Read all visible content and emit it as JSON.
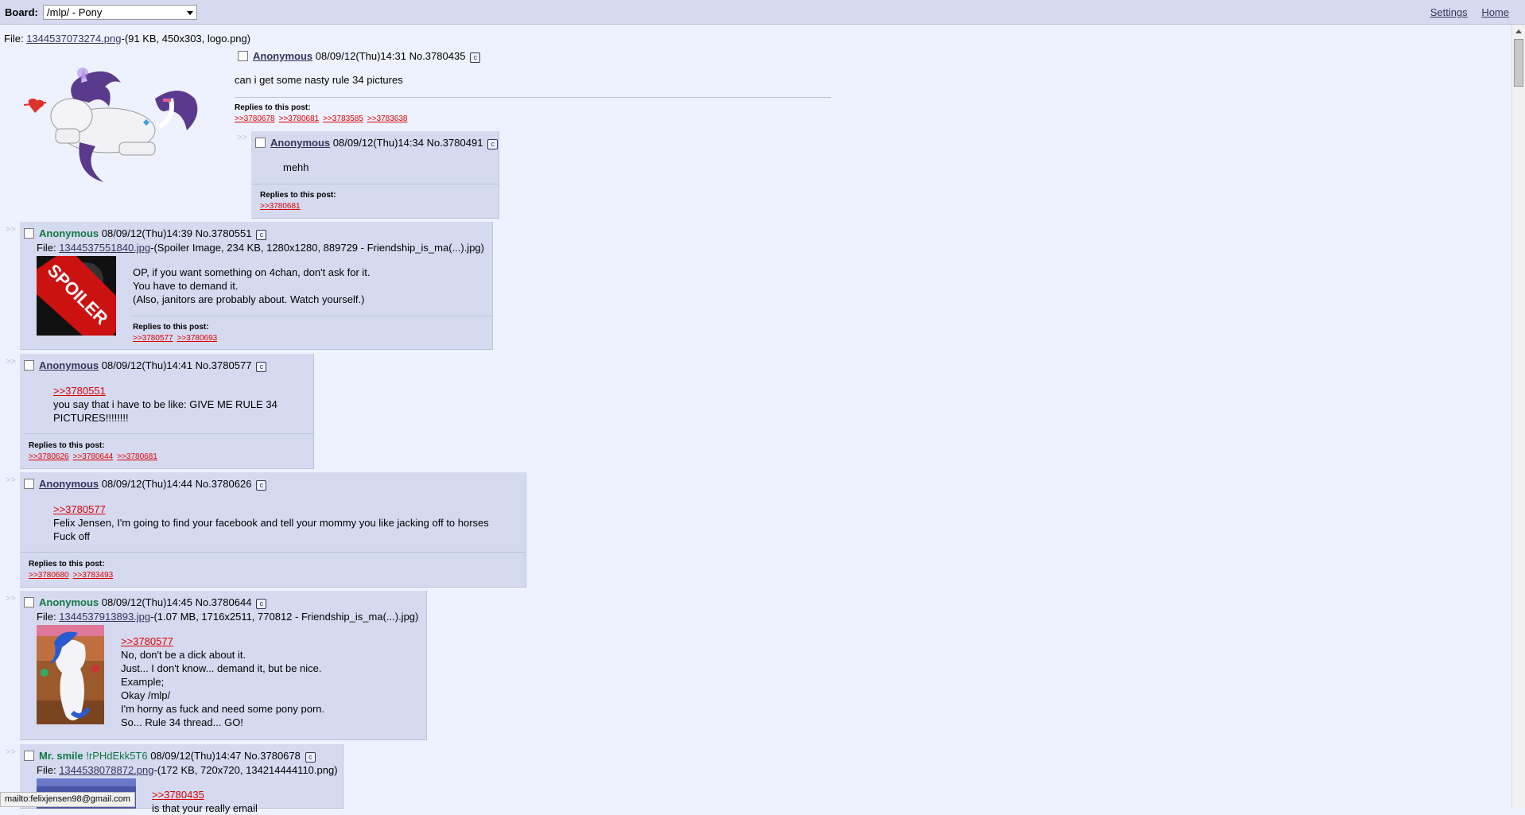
{
  "header": {
    "board_label": "Board:",
    "board_select": "/mlp/ - Pony",
    "settings": "Settings",
    "home": "Home"
  },
  "op": {
    "file_label": "File:",
    "file_link": "1344537073274.png",
    "file_meta": "-(91 KB, 450x303, logo.png)",
    "name": "Anonymous",
    "datetime": "08/09/12(Thu)14:31",
    "no": "No.3780435",
    "message": "can i get some nasty rule 34 pictures",
    "replies_title": "Replies to this post:",
    "replies": [
      ">>3780678",
      ">>3780681",
      ">>3783585",
      ">>3783638"
    ]
  },
  "inline_reply": {
    "name": "Anonymous",
    "datetime": "08/09/12(Thu)14:34",
    "no": "No.3780491",
    "message": "mehh",
    "replies_title": "Replies to this post:",
    "replies": [
      ">>3780681"
    ]
  },
  "posts": [
    {
      "name": "Anonymous",
      "datetime": "08/09/12(Thu)14:39",
      "no": "No.3780551",
      "file_label": "File:",
      "file_link": "1344537551840.jpg",
      "file_meta": "-(Spoiler Image, 234 KB, 1280x1280, 889729 - Friendship_is_ma(...).jpg)",
      "spoiler_text": "SPOILER",
      "lines": [
        "OP, if you want something on 4chan, don't ask for it.",
        "You have to demand it.",
        "(Also, janitors are probably about. Watch yourself.)"
      ],
      "replies_title": "Replies to this post:",
      "replies": [
        ">>3780577",
        ">>3780693"
      ]
    },
    {
      "name": "Anonymous",
      "datetime": "08/09/12(Thu)14:41",
      "no": "No.3780577",
      "quote": ">>3780551",
      "lines": [
        "you say that i have to be like: GIVE ME RULE 34",
        "PICTURES!!!!!!!!"
      ],
      "replies_title": "Replies to this post:",
      "replies": [
        ">>3780626",
        ">>3780644",
        ">>3780681"
      ]
    },
    {
      "name": "Anonymous",
      "datetime": "08/09/12(Thu)14:44",
      "no": "No.3780626",
      "quote": ">>3780577",
      "lines": [
        "Felix Jensen, I'm going to find your facebook and tell your mommy you like jacking off to horses",
        "Fuck off"
      ],
      "replies_title": "Replies to this post:",
      "replies": [
        ">>3780680",
        ">>3783493"
      ]
    },
    {
      "name": "Anonymous",
      "datetime": "08/09/12(Thu)14:45",
      "no": "No.3780644",
      "file_label": "File:",
      "file_link": "1344537913893.jpg",
      "file_meta": "-(1.07 MB, 1716x2511, 770812 - Friendship_is_ma(...).jpg)",
      "quote": ">>3780577",
      "lines": [
        "No, don't be a dick about it.",
        "Just... I don't know... demand it, but be nice.",
        "Example;",
        "Okay /mlp/",
        "I'm horny as fuck and need some pony porn.",
        "So... Rule 34 thread... GO!"
      ]
    },
    {
      "name": "Mr. smile",
      "trip": "!rPHdEkk5T6",
      "datetime": "08/09/12(Thu)14:47",
      "no": "No.3780678",
      "file_label": "File:",
      "file_link": "1344538078872.png",
      "file_meta": "-(172 KB, 720x720, 134214444110.png)",
      "quote": ">>3780435",
      "lines": [
        "is that your really email"
      ]
    }
  ],
  "arrows": ">>",
  "status_bar": "mailto:felixjensen98@gmail.com",
  "colors": {
    "background": "#eef2ff",
    "reply_bg": "#d6daf0",
    "name": "#117743",
    "quotelink": "#dd0000"
  }
}
